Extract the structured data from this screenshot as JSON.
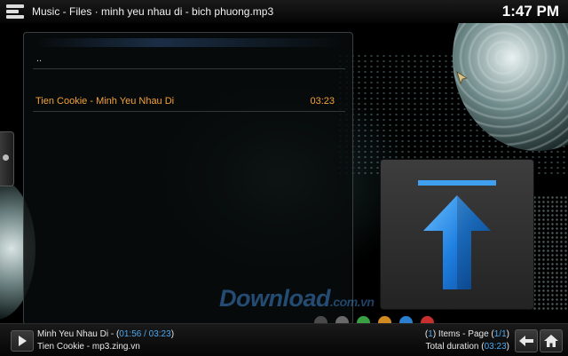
{
  "header": {
    "breadcrumb": "Music - Files  ·  minh yeu nhau di - bich phuong.mp3",
    "clock": "1:47 PM"
  },
  "file_list": {
    "parent_label": "..",
    "items": [
      {
        "title": "Tien Cookie - Minh Yeu Nhau Di",
        "duration": "03:23"
      }
    ]
  },
  "thumb": {
    "icon": "up-arrow-icon"
  },
  "watermark": {
    "text": "Download",
    "suffix": ".com.vn"
  },
  "color_dots": [
    "#4a4a4a",
    "#6a6a6a",
    "#3aa044",
    "#d08a20",
    "#2a7fd0",
    "#c83030"
  ],
  "now_playing": {
    "title": "Minh Yeu Nhau Di - ",
    "time": "01:56 / 03:23",
    "subtitle": "Tien Cookie - mp3.zing.vn"
  },
  "stats": {
    "items_count": "1",
    "items_label": " Items - Page ",
    "page": "1/1",
    "total_label": "Total duration ",
    "total_duration": "03:23"
  },
  "colors": {
    "accent": "#f3a33a",
    "highlight": "#4aa8f0"
  }
}
